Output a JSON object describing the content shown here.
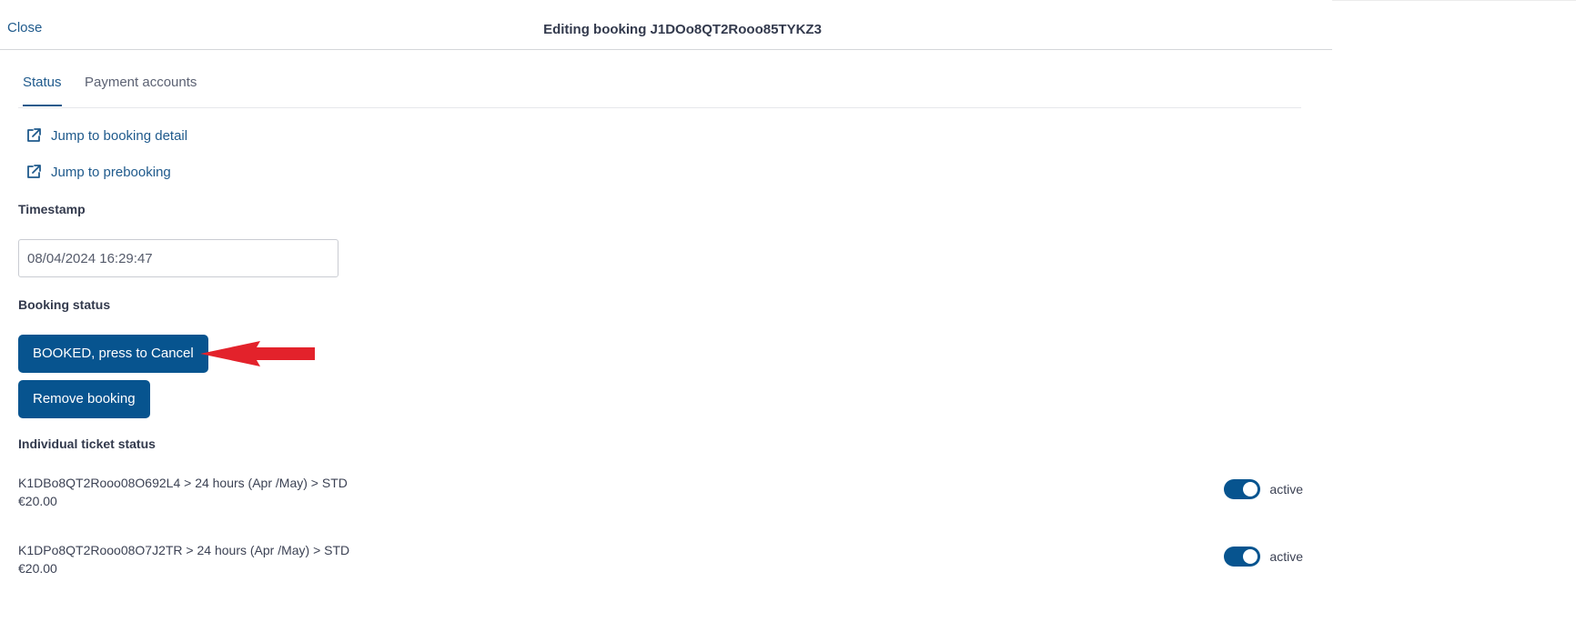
{
  "header": {
    "close_label": "Close",
    "title": "Editing booking J1DOo8QT2Rooo85TYKZ3"
  },
  "tabs": [
    {
      "label": "Status",
      "active": true
    },
    {
      "label": "Payment accounts",
      "active": false
    }
  ],
  "links": {
    "booking_detail": "Jump to booking detail",
    "prebooking": "Jump to prebooking"
  },
  "timestamp": {
    "label": "Timestamp",
    "value": "08/04/2024 16:29:47"
  },
  "booking_status": {
    "label": "Booking status",
    "cancel_button": "BOOKED, press to Cancel",
    "remove_button": "Remove booking"
  },
  "tickets": {
    "label": "Individual ticket status",
    "items": [
      {
        "name": "K1DBo8QT2Rooo08O692L4 > 24 hours (Apr /May) > STD",
        "price": "€20.00",
        "status": "active",
        "enabled": true
      },
      {
        "name": "K1DPo8QT2Rooo08O7J2TR > 24 hours (Apr /May) > STD",
        "price": "€20.00",
        "status": "active",
        "enabled": true
      }
    ]
  },
  "colors": {
    "accent": "#07548f",
    "link": "#1f5a8c",
    "annotation_arrow": "#e3222b"
  },
  "icons": {
    "link_icon": "external-link-icon",
    "annotation": "red-arrow-icon"
  }
}
